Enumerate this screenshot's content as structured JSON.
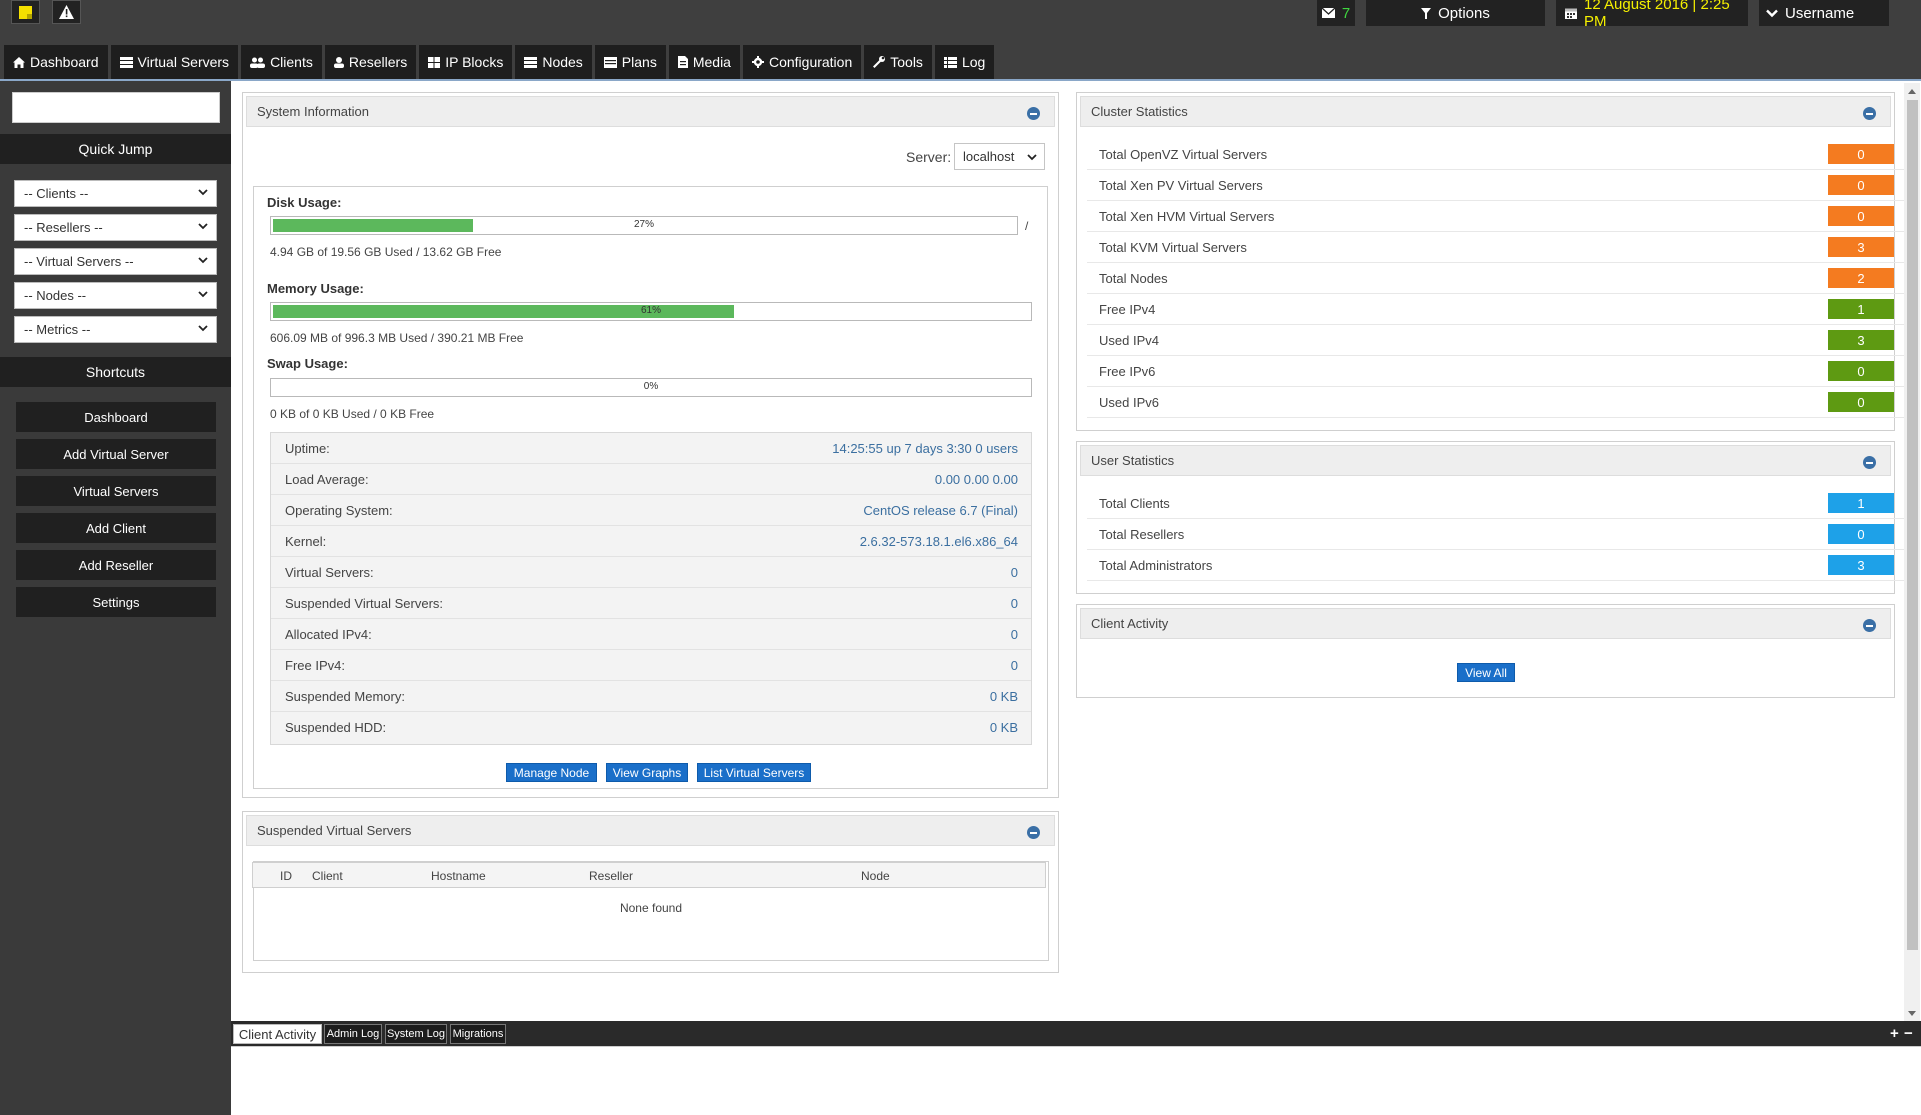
{
  "topbar": {
    "mail_count": "7",
    "options_label": "Options",
    "datetime": "12 August 2016 | 2:25 PM",
    "username": "Username"
  },
  "menu": [
    {
      "label": "Dashboard",
      "icon": "home-icon"
    },
    {
      "label": "Virtual Servers",
      "icon": "server-icon"
    },
    {
      "label": "Clients",
      "icon": "users-icon"
    },
    {
      "label": "Resellers",
      "icon": "user-icon"
    },
    {
      "label": "IP Blocks",
      "icon": "grid-icon"
    },
    {
      "label": "Nodes",
      "icon": "node-icon"
    },
    {
      "label": "Plans",
      "icon": "plans-icon"
    },
    {
      "label": "Media",
      "icon": "file-icon"
    },
    {
      "label": "Configuration",
      "icon": "gear-icon"
    },
    {
      "label": "Tools",
      "icon": "wrench-icon"
    },
    {
      "label": "Log",
      "icon": "list-icon"
    }
  ],
  "sidebar": {
    "quick_jump": "Quick Jump",
    "selects": [
      "-- Clients --",
      "-- Resellers --",
      "-- Virtual Servers --",
      "-- Nodes --",
      "-- Metrics --"
    ],
    "shortcuts": "Shortcuts",
    "buttons": [
      "Dashboard",
      "Add Virtual Server",
      "Virtual Servers",
      "Add Client",
      "Add Reseller",
      "Settings"
    ]
  },
  "system_info": {
    "title": "System Information",
    "server_label": "Server:",
    "server_value": "localhost",
    "disk": {
      "label": "Disk Usage:",
      "percent": 27,
      "percent_text": "27%",
      "detail": "4.94 GB of 19.56 GB Used / 13.62 GB Free",
      "trailing": "/"
    },
    "memory": {
      "label": "Memory Usage:",
      "percent": 61,
      "percent_text": "61%",
      "detail": "606.09 MB of 996.3 MB Used / 390.21 MB Free"
    },
    "swap": {
      "label": "Swap Usage:",
      "percent": 0,
      "percent_text": "0%",
      "detail": "0 KB of 0 KB Used / 0 KB Free"
    },
    "rows": [
      {
        "k": "Uptime:",
        "v": "14:25:55 up 7 days 3:30 0 users"
      },
      {
        "k": "Load Average:",
        "v": "0.00 0.00 0.00"
      },
      {
        "k": "Operating System:",
        "v": "CentOS release 6.7 (Final)"
      },
      {
        "k": "Kernel:",
        "v": "2.6.32-573.18.1.el6.x86_64"
      },
      {
        "k": "Virtual Servers:",
        "v": "0"
      },
      {
        "k": "Suspended Virtual Servers:",
        "v": "0"
      },
      {
        "k": "Allocated IPv4:",
        "v": "0"
      },
      {
        "k": "Free IPv4:",
        "v": "0"
      },
      {
        "k": "Suspended Memory:",
        "v": "0 KB"
      },
      {
        "k": "Suspended HDD:",
        "v": "0 KB"
      }
    ],
    "buttons": [
      "Manage Node",
      "View Graphs",
      "List Virtual Servers"
    ]
  },
  "suspended": {
    "title": "Suspended Virtual Servers",
    "columns": [
      "ID",
      "Client",
      "Hostname",
      "Reseller",
      "Node"
    ],
    "empty": "None found"
  },
  "cluster": {
    "title": "Cluster Statistics",
    "rows": [
      {
        "k": "Total OpenVZ Virtual Servers",
        "v": "0",
        "color": "#f47b20"
      },
      {
        "k": "Total Xen PV Virtual Servers",
        "v": "0",
        "color": "#f47b20"
      },
      {
        "k": "Total Xen HVM Virtual Servers",
        "v": "0",
        "color": "#f47b20"
      },
      {
        "k": "Total KVM Virtual Servers",
        "v": "3",
        "color": "#f47b20"
      },
      {
        "k": "Total Nodes",
        "v": "2",
        "color": "#f47b20"
      },
      {
        "k": "Free IPv4",
        "v": "1",
        "color": "#5e9a12"
      },
      {
        "k": "Used IPv4",
        "v": "3",
        "color": "#5e9a12"
      },
      {
        "k": "Free IPv6",
        "v": "0",
        "color": "#5e9a12"
      },
      {
        "k": "Used IPv6",
        "v": "0",
        "color": "#5e9a12"
      }
    ]
  },
  "user_stats": {
    "title": "User Statistics",
    "rows": [
      {
        "k": "Total Clients",
        "v": "1",
        "color": "#1ea1e8"
      },
      {
        "k": "Total Resellers",
        "v": "0",
        "color": "#1ea1e8"
      },
      {
        "k": "Total Administrators",
        "v": "3",
        "color": "#1ea1e8"
      }
    ]
  },
  "client_activity": {
    "title": "Client Activity",
    "view_all": "View All"
  },
  "log_tabs": [
    "Client Activity",
    "Admin Log",
    "System Log",
    "Migrations"
  ],
  "log_controls": {
    "expand": "+",
    "collapse": "−"
  }
}
